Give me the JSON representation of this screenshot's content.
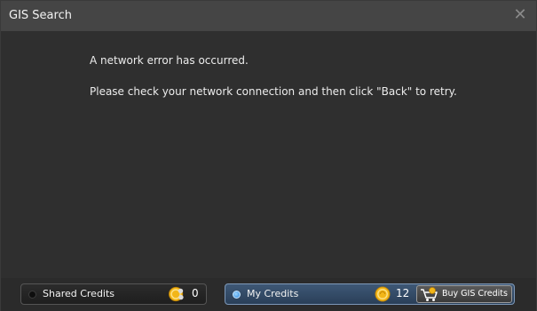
{
  "window": {
    "title": "GIS Search"
  },
  "message": {
    "line1": "A network error has occurred.",
    "line2": "Please check your network connection and then click \"Back\" to retry."
  },
  "credits": {
    "shared": {
      "label": "Shared Credits",
      "count": "0",
      "selected": false
    },
    "mine": {
      "label": "My Credits",
      "count": "12",
      "selected": true
    },
    "buy_label": "Buy GIS Credits"
  },
  "icons": {
    "close": "close-icon",
    "coin": "coin-icon",
    "shared_coin": "shared-coin-icon",
    "cart": "cart-icon",
    "radio_off": "radio-off",
    "radio_on": "radio-on"
  },
  "colors": {
    "title_bar": "#454545",
    "background": "#2f2f2f",
    "accent": "#3e5876",
    "coin": "#f2b619"
  }
}
